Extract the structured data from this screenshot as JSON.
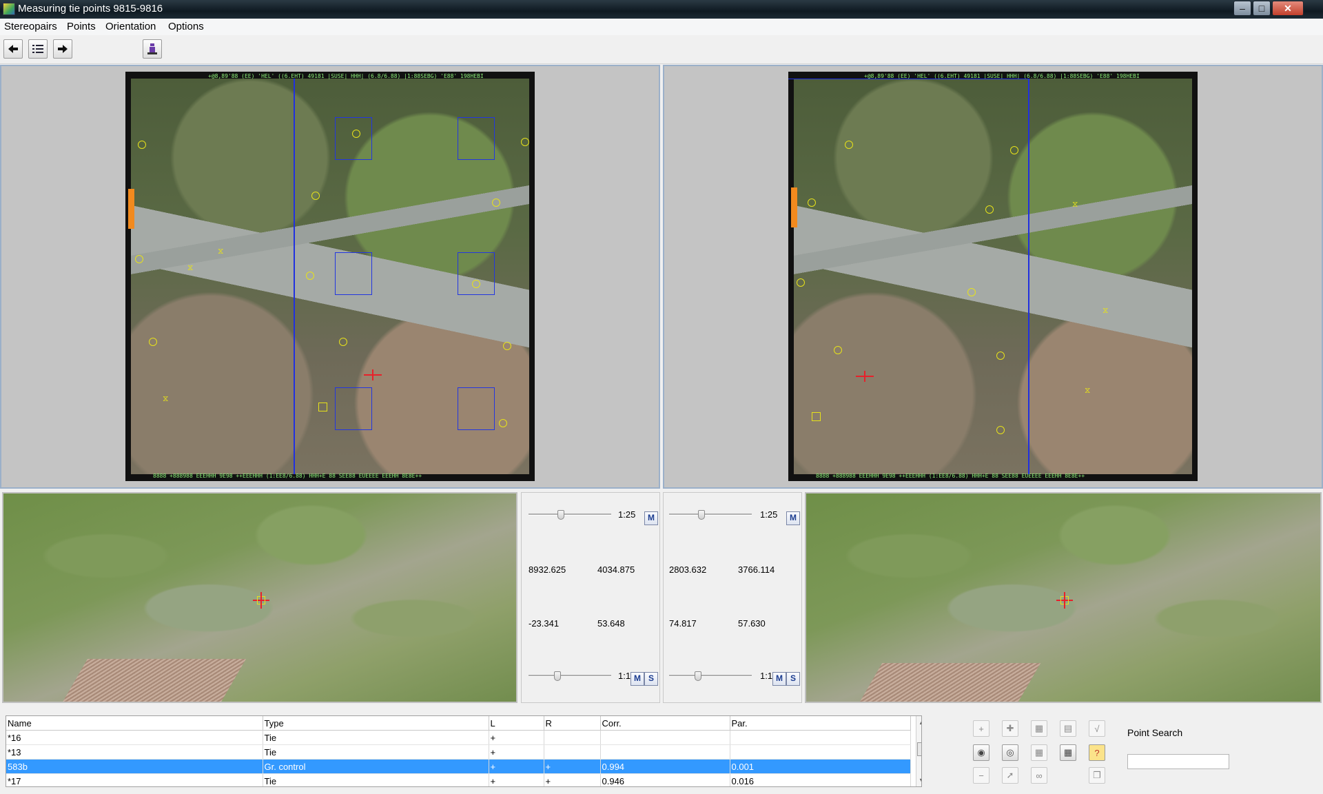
{
  "window": {
    "title": "Measuring tie points 9815-9816"
  },
  "menu": [
    "Stereopairs",
    "Points",
    "Orientation",
    "Options"
  ],
  "toolbar": {
    "icons": [
      "arrow-left-icon",
      "list-icon",
      "arrow-right-icon",
      "person-icon"
    ]
  },
  "left_info": {
    "zoom_top": "1:25",
    "coord_x": "8932.625",
    "coord_y": "4034.875",
    "offset_x": "-23.341",
    "offset_y": "53.648",
    "zoom_bottom": "1:1",
    "m_label": "M",
    "s_label": "S"
  },
  "right_info": {
    "zoom_top": "1:25",
    "coord_x": "2803.632",
    "coord_y": "3766.114",
    "offset_x": "74.817",
    "offset_y": "57.630",
    "zoom_bottom": "1:1",
    "m_label": "M",
    "s_label": "S"
  },
  "table": {
    "headers": [
      "Name",
      "Type",
      "L",
      "R",
      "Corr.",
      "Par."
    ],
    "rows": [
      {
        "name": "*16",
        "type": "Tie",
        "l": "+",
        "r": "",
        "corr": "",
        "par": ""
      },
      {
        "name": "*13",
        "type": "Tie",
        "l": "+",
        "r": "",
        "corr": "",
        "par": ""
      },
      {
        "name": "583b",
        "type": "Gr. control",
        "l": "+",
        "r": "+",
        "corr": "0.994",
        "par": "0.001",
        "selected": true
      },
      {
        "name": "*17",
        "type": "Tie",
        "l": "+",
        "r": "+",
        "corr": "0.946",
        "par": "0.016"
      }
    ]
  },
  "point_search": {
    "label": "Point Search",
    "value": ""
  },
  "colors": {
    "selection": "#3399ff",
    "marker_yellow": "#e7e21a",
    "marker_red": "#e8202a",
    "strip_blue": "#2030e0"
  }
}
